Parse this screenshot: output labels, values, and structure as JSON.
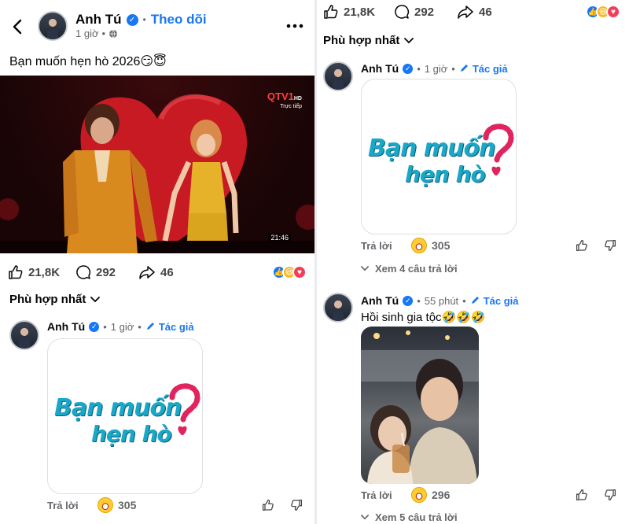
{
  "post": {
    "author": "Anh Tú",
    "follow_label": "Theo dõi",
    "time": "1 giờ",
    "caption": "Bạn muốn hẹn hò 2026😏😇",
    "video_channel": "QTV1",
    "video_channel_hd": "HD",
    "video_live": "Trực tiếp",
    "video_time": "21:46",
    "likes": "21,8K",
    "comments": "292",
    "shares": "46",
    "sort_label": "Phù hợp nhất"
  },
  "comments": [
    {
      "author": "Anh Tú",
      "time": "1 giờ",
      "author_badge": "Tác giả",
      "text": "",
      "logo_line1": "Bạn muốn",
      "logo_line2": "hẹn hò",
      "reply_label": "Trả lời",
      "reaction_count": "305",
      "view_replies": "Xem 4 câu trả lời"
    },
    {
      "author": "Anh Tú",
      "time": "55 phút",
      "author_badge": "Tác giả",
      "text": "Hồi sinh gia tộc🤣🤣🤣",
      "reply_label": "Trả lời",
      "reaction_count": "296",
      "view_replies": "Xem 5 câu trả lời"
    }
  ],
  "colors": {
    "accent": "#1877f2",
    "gray_text": "#65676b",
    "logo_blue": "#1aa7c8",
    "logo_pink": "#e0245e"
  },
  "icons": [
    "back-arrow-icon",
    "verified-icon",
    "globe-icon",
    "more-icon",
    "like-icon",
    "comment-icon",
    "share-icon",
    "chevron-down-icon",
    "pencil-icon",
    "dislike-icon"
  ]
}
